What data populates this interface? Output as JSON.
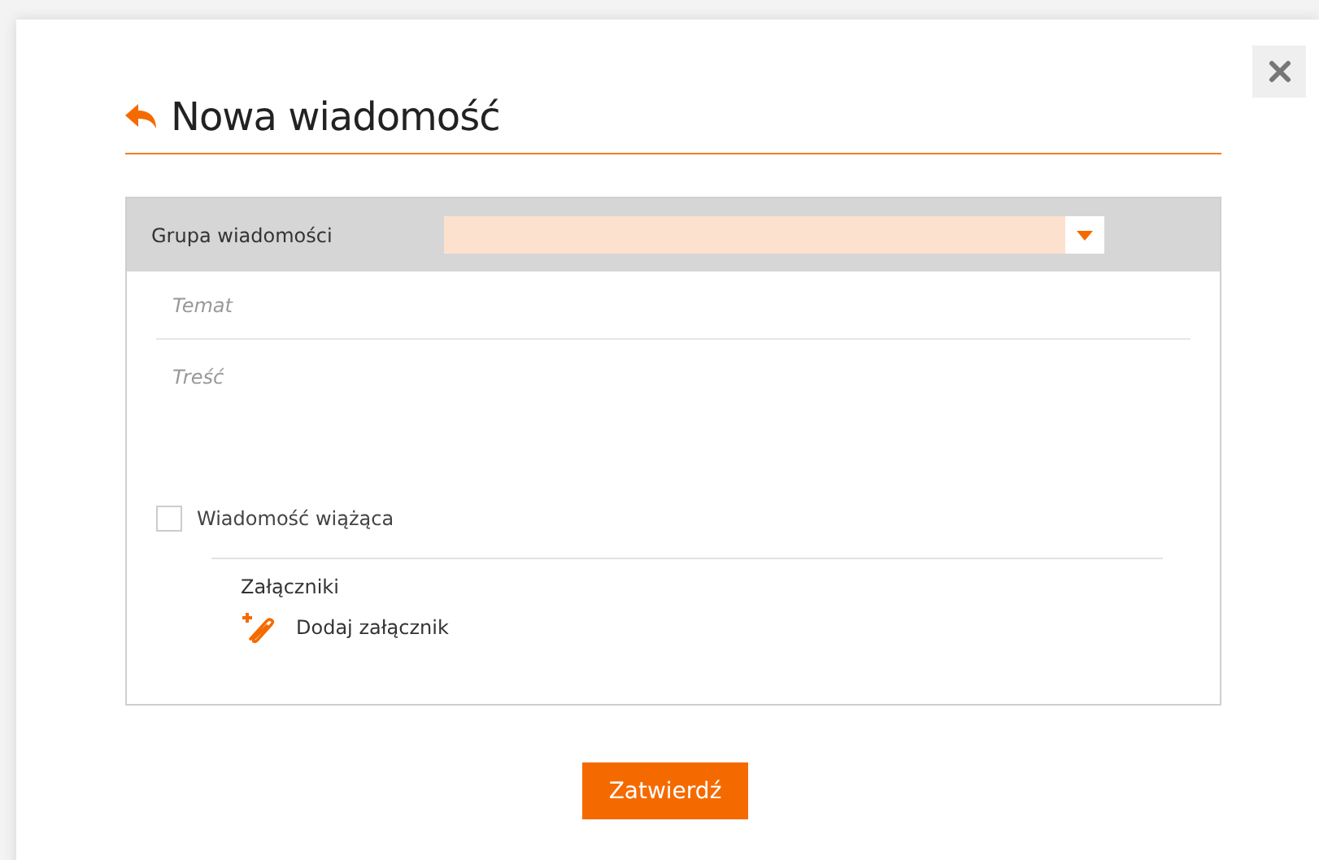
{
  "dialog": {
    "title": "Nowa wiadomość"
  },
  "form": {
    "group": {
      "label": "Grupa wiadomości"
    },
    "subject": {
      "placeholder": "Temat"
    },
    "body": {
      "placeholder": "Treść"
    },
    "binding": {
      "label": "Wiadomość wiążąca",
      "checked": false
    },
    "attachments": {
      "label": "Załączniki",
      "add_link": "Dodaj załącznik"
    }
  },
  "submit": "Zatwierdź"
}
